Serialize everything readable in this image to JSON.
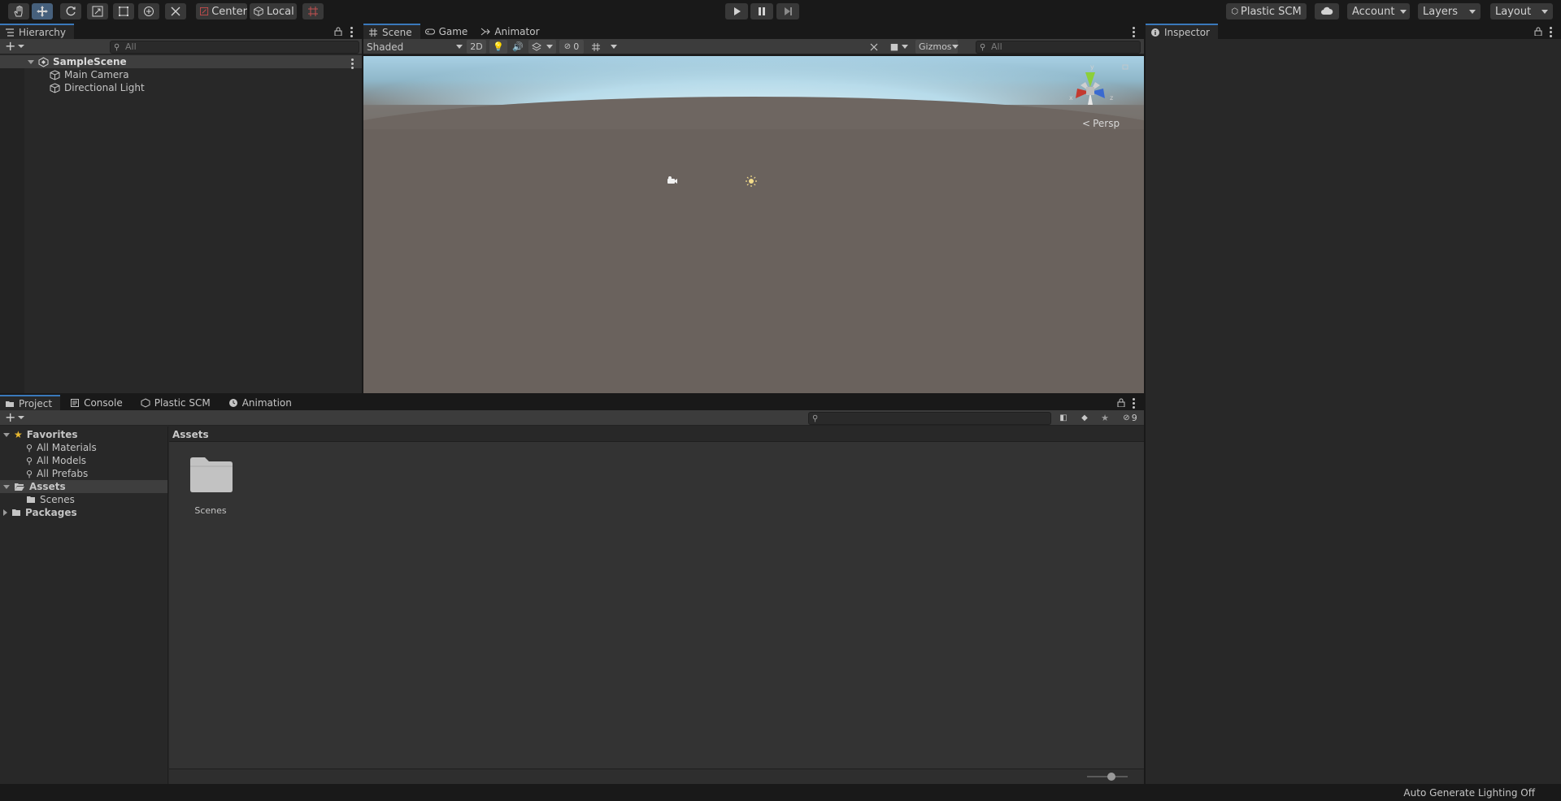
{
  "toolbar": {
    "pivot_label": "Center",
    "space_label": "Local",
    "plastic_label": "Plastic SCM",
    "account_label": "Account",
    "layers_label": "Layers",
    "layout_label": "Layout"
  },
  "hierarchy": {
    "tab_label": "Hierarchy",
    "search_placeholder": "All",
    "scene_name": "SampleScene",
    "items": [
      {
        "label": "Main Camera"
      },
      {
        "label": "Directional Light"
      }
    ]
  },
  "scene_view": {
    "tabs": [
      {
        "label": "Scene"
      },
      {
        "label": "Game"
      },
      {
        "label": "Animator"
      }
    ],
    "draw_mode": "Shaded",
    "mode_2d": "2D",
    "hidden_count": "0",
    "gizmos_label": "Gizmos",
    "search_placeholder": "All",
    "projection_label": "Persp",
    "axis_x": "x",
    "axis_y": "y",
    "axis_z": "z"
  },
  "inspector": {
    "tab_label": "Inspector"
  },
  "project": {
    "tabs": [
      {
        "label": "Project"
      },
      {
        "label": "Console"
      },
      {
        "label": "Plastic SCM"
      },
      {
        "label": "Animation"
      }
    ],
    "hidden_count": "9",
    "favorites_label": "Favorites",
    "favorites": [
      {
        "label": "All Materials"
      },
      {
        "label": "All Models"
      },
      {
        "label": "All Prefabs"
      }
    ],
    "assets_label": "Assets",
    "assets_children": [
      {
        "label": "Scenes"
      }
    ],
    "packages_label": "Packages",
    "breadcrumb": "Assets",
    "grid_items": [
      {
        "label": "Scenes"
      }
    ],
    "zoom_value": 0.6
  },
  "status_bar": {
    "text": "Auto Generate Lighting Off"
  },
  "colors": {
    "accent": "#3a79bb",
    "panel": "#282828",
    "selection": "#46607c"
  }
}
